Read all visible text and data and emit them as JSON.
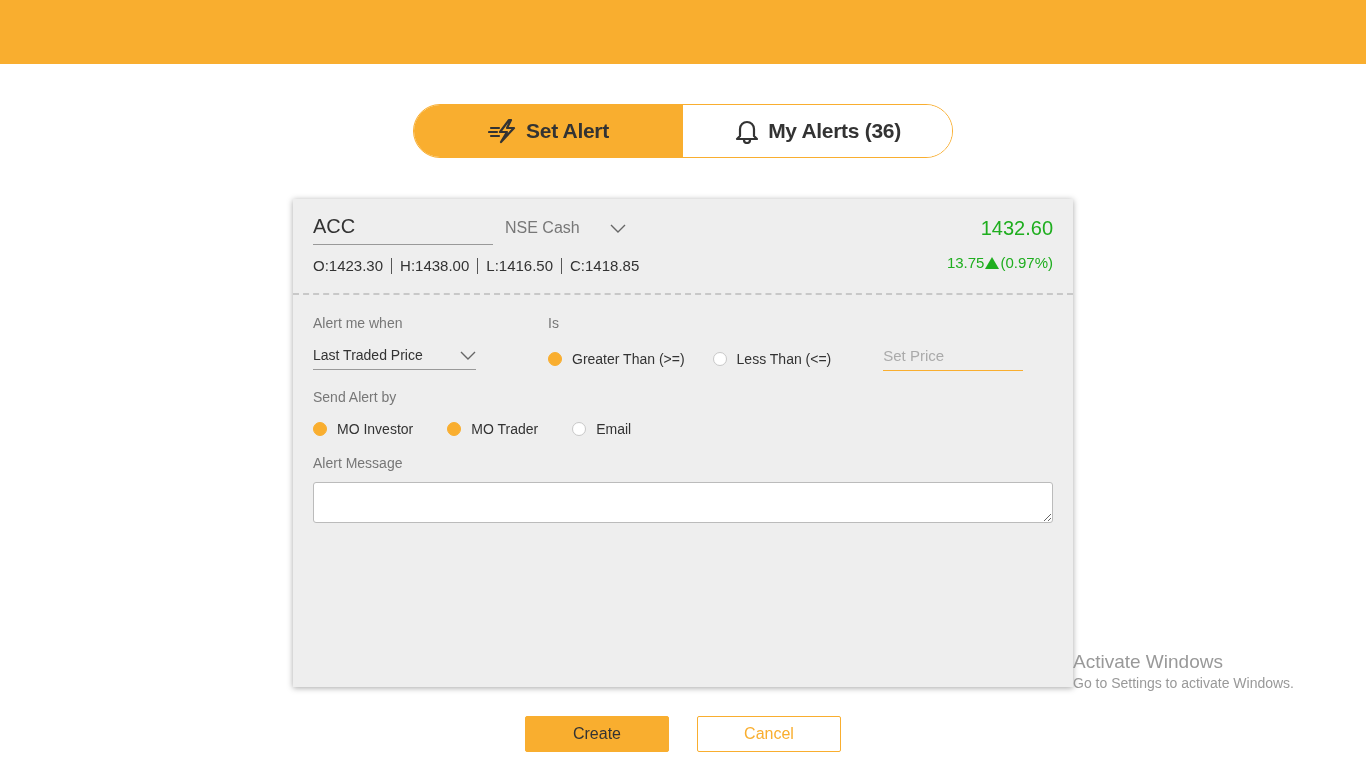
{
  "tabs": [
    {
      "kind": "set",
      "label": "Set Alert",
      "selected": true
    },
    {
      "kind": "list",
      "label": "My Alerts (36)",
      "selected": false
    }
  ],
  "quote": {
    "symbol": "ACC",
    "exchange": "NSE Cash",
    "price": "1432.60",
    "change": "13.75",
    "change_pct": "(0.97%)",
    "ohlc": [
      "O:1423.30",
      "H:1438.00",
      "L:1416.50",
      "C:1418.85"
    ]
  },
  "condition": {
    "label": "Alert me when",
    "value": "Last Traded Price"
  },
  "comparison": {
    "label": "Is",
    "options": [
      {
        "label": "Greater Than (>=)",
        "selected": true
      },
      {
        "label": "Less Than (<=)",
        "selected": false
      }
    ],
    "price_placeholder": "Set Price"
  },
  "send_by": {
    "label": "Send Alert by",
    "options": [
      {
        "label": "MO Investor",
        "checked": true
      },
      {
        "label": "MO Trader",
        "checked": true
      },
      {
        "label": "Email",
        "checked": false
      }
    ]
  },
  "message": {
    "label": "Alert Message"
  },
  "buttons": [
    {
      "kind": "primary",
      "label": "Create"
    },
    {
      "kind": "secondary",
      "label": "Cancel"
    }
  ],
  "os_notice": {
    "title": "Activate Windows",
    "text": "Go to Settings to activate Windows."
  }
}
